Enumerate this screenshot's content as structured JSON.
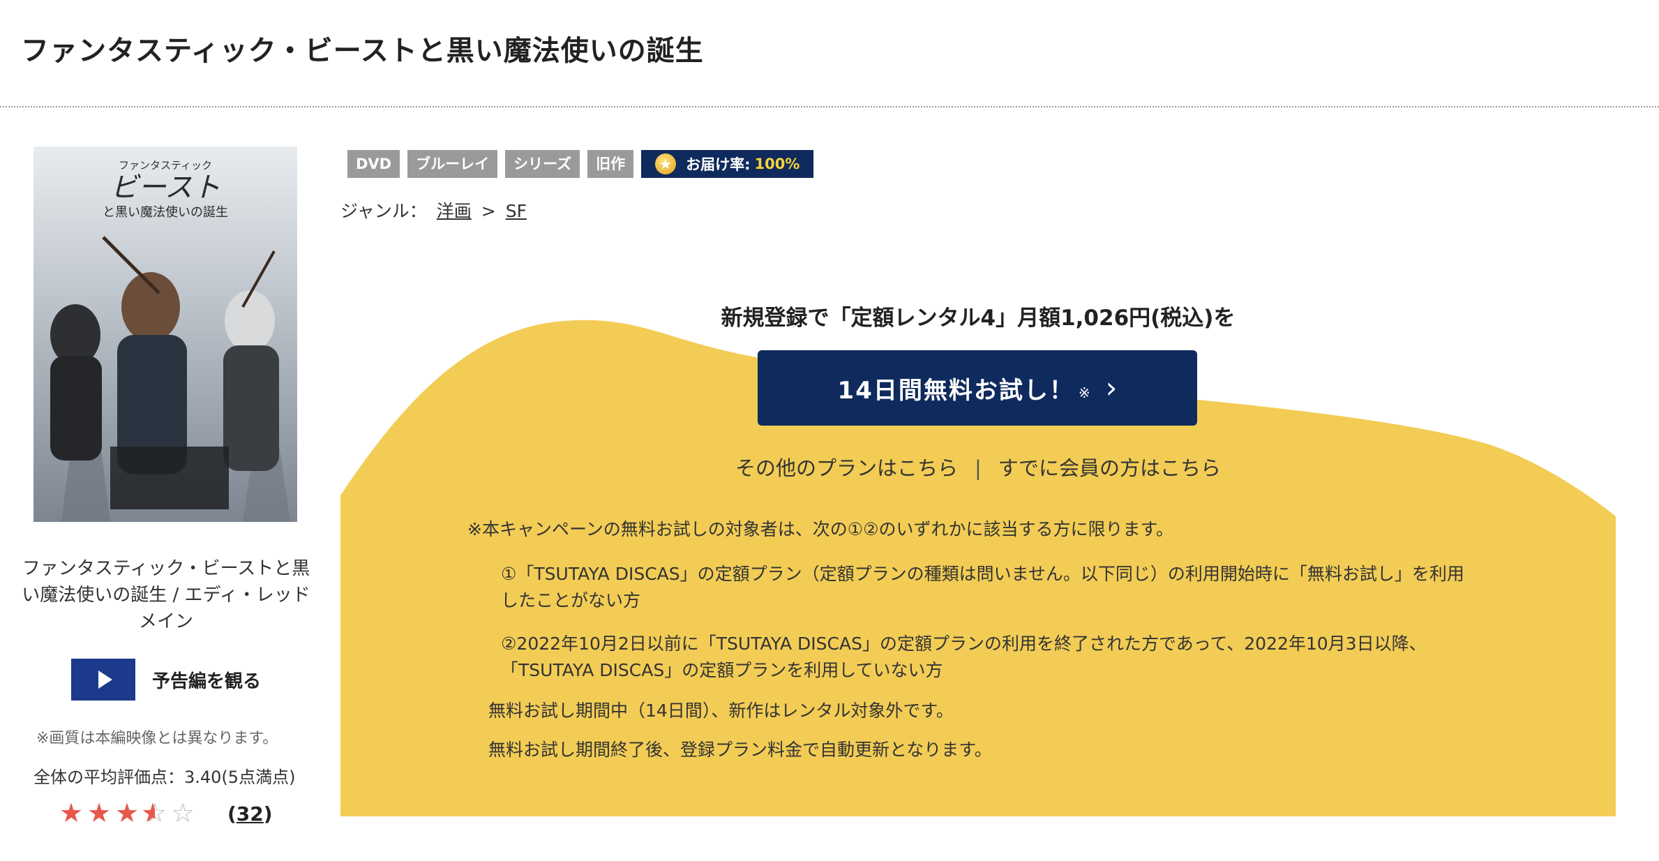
{
  "page": {
    "title": "ファンタスティック・ビーストと黒い魔法使いの誕生"
  },
  "cover": {
    "title_small": "ファンタスティック",
    "title_main": "ビースト",
    "title_sub": "と黒い魔法使いの誕生"
  },
  "sidebar": {
    "caption": "ファンタスティック・ビーストと黒い魔法使いの誕生 / エディ・レッドメイン",
    "trailer_label": "予告編を観る",
    "quality_note": "※画質は本編映像とは異なります。",
    "avg_rating_text": "全体の平均評価点：3.40(5点満点)",
    "rating_value": 3.4,
    "rating_max": 5,
    "review_count": "32",
    "review_count_open": "(",
    "review_count_close": ")"
  },
  "tags": [
    "DVD",
    "ブルーレイ",
    "シリーズ",
    "旧作"
  ],
  "delivery": {
    "label": "お届け率:",
    "rate": "100%"
  },
  "genre": {
    "label": "ジャンル：",
    "items": [
      "洋画",
      "SF"
    ],
    "separator": ">"
  },
  "promo": {
    "headline": "新規登録で「定額レンタル4」月額1,026円(税込)を",
    "cta_label": "14日間無料お試し！",
    "cta_mark": "※",
    "other_plans": "その他のプランはこちら",
    "separator": "|",
    "members": "すでに会員の方はこちら",
    "note_intro": "※本キャンペーンの無料お試しの対象者は、次の①②のいずれかに該当する方に限ります。",
    "note_1": "①「TSUTAYA DISCAS」の定額プラン（定額プランの種類は問いません。以下同じ）の利用開始時に「無料お試し」を利用したことがない方",
    "note_2": "②2022年10月2日以前に「TSUTAYA DISCAS」の定額プランの利用を終了された方であって、2022年10月3日以降、「TSUTAYA DISCAS」の定額プランを利用していない方",
    "note_3": "無料お試し期間中（14日間）、新作はレンタル対象外です。",
    "note_4": "無料お試し期間終了後、登録プラン料金で自動更新となります。"
  },
  "colors": {
    "navy": "#0f2a5c",
    "promo_yellow": "#f2cc55",
    "tag_gray": "#9a9a9a",
    "star_red": "#e8584a",
    "delivery_rate": "#f6d33a"
  }
}
